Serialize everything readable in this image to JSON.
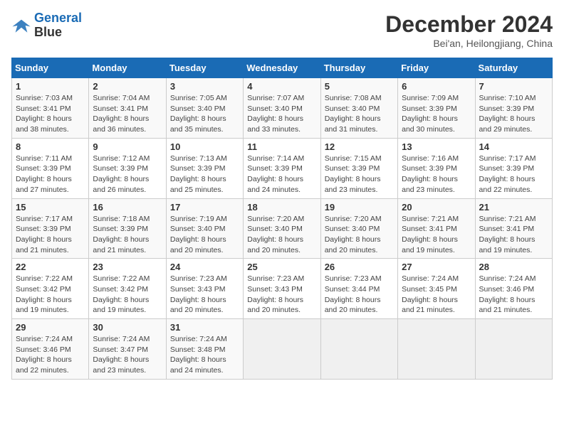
{
  "header": {
    "logo_line1": "General",
    "logo_line2": "Blue",
    "month_title": "December 2024",
    "location": "Bei'an, Heilongjiang, China"
  },
  "weekdays": [
    "Sunday",
    "Monday",
    "Tuesday",
    "Wednesday",
    "Thursday",
    "Friday",
    "Saturday"
  ],
  "weeks": [
    [
      {
        "day": "1",
        "sunrise": "7:03 AM",
        "sunset": "3:41 PM",
        "daylight": "8 hours and 38 minutes."
      },
      {
        "day": "2",
        "sunrise": "7:04 AM",
        "sunset": "3:41 PM",
        "daylight": "8 hours and 36 minutes."
      },
      {
        "day": "3",
        "sunrise": "7:05 AM",
        "sunset": "3:40 PM",
        "daylight": "8 hours and 35 minutes."
      },
      {
        "day": "4",
        "sunrise": "7:07 AM",
        "sunset": "3:40 PM",
        "daylight": "8 hours and 33 minutes."
      },
      {
        "day": "5",
        "sunrise": "7:08 AM",
        "sunset": "3:40 PM",
        "daylight": "8 hours and 31 minutes."
      },
      {
        "day": "6",
        "sunrise": "7:09 AM",
        "sunset": "3:39 PM",
        "daylight": "8 hours and 30 minutes."
      },
      {
        "day": "7",
        "sunrise": "7:10 AM",
        "sunset": "3:39 PM",
        "daylight": "8 hours and 29 minutes."
      }
    ],
    [
      {
        "day": "8",
        "sunrise": "7:11 AM",
        "sunset": "3:39 PM",
        "daylight": "8 hours and 27 minutes."
      },
      {
        "day": "9",
        "sunrise": "7:12 AM",
        "sunset": "3:39 PM",
        "daylight": "8 hours and 26 minutes."
      },
      {
        "day": "10",
        "sunrise": "7:13 AM",
        "sunset": "3:39 PM",
        "daylight": "8 hours and 25 minutes."
      },
      {
        "day": "11",
        "sunrise": "7:14 AM",
        "sunset": "3:39 PM",
        "daylight": "8 hours and 24 minutes."
      },
      {
        "day": "12",
        "sunrise": "7:15 AM",
        "sunset": "3:39 PM",
        "daylight": "8 hours and 23 minutes."
      },
      {
        "day": "13",
        "sunrise": "7:16 AM",
        "sunset": "3:39 PM",
        "daylight": "8 hours and 23 minutes."
      },
      {
        "day": "14",
        "sunrise": "7:17 AM",
        "sunset": "3:39 PM",
        "daylight": "8 hours and 22 minutes."
      }
    ],
    [
      {
        "day": "15",
        "sunrise": "7:17 AM",
        "sunset": "3:39 PM",
        "daylight": "8 hours and 21 minutes."
      },
      {
        "day": "16",
        "sunrise": "7:18 AM",
        "sunset": "3:39 PM",
        "daylight": "8 hours and 21 minutes."
      },
      {
        "day": "17",
        "sunrise": "7:19 AM",
        "sunset": "3:40 PM",
        "daylight": "8 hours and 20 minutes."
      },
      {
        "day": "18",
        "sunrise": "7:20 AM",
        "sunset": "3:40 PM",
        "daylight": "8 hours and 20 minutes."
      },
      {
        "day": "19",
        "sunrise": "7:20 AM",
        "sunset": "3:40 PM",
        "daylight": "8 hours and 20 minutes."
      },
      {
        "day": "20",
        "sunrise": "7:21 AM",
        "sunset": "3:41 PM",
        "daylight": "8 hours and 19 minutes."
      },
      {
        "day": "21",
        "sunrise": "7:21 AM",
        "sunset": "3:41 PM",
        "daylight": "8 hours and 19 minutes."
      }
    ],
    [
      {
        "day": "22",
        "sunrise": "7:22 AM",
        "sunset": "3:42 PM",
        "daylight": "8 hours and 19 minutes."
      },
      {
        "day": "23",
        "sunrise": "7:22 AM",
        "sunset": "3:42 PM",
        "daylight": "8 hours and 19 minutes."
      },
      {
        "day": "24",
        "sunrise": "7:23 AM",
        "sunset": "3:43 PM",
        "daylight": "8 hours and 20 minutes."
      },
      {
        "day": "25",
        "sunrise": "7:23 AM",
        "sunset": "3:43 PM",
        "daylight": "8 hours and 20 minutes."
      },
      {
        "day": "26",
        "sunrise": "7:23 AM",
        "sunset": "3:44 PM",
        "daylight": "8 hours and 20 minutes."
      },
      {
        "day": "27",
        "sunrise": "7:24 AM",
        "sunset": "3:45 PM",
        "daylight": "8 hours and 21 minutes."
      },
      {
        "day": "28",
        "sunrise": "7:24 AM",
        "sunset": "3:46 PM",
        "daylight": "8 hours and 21 minutes."
      }
    ],
    [
      {
        "day": "29",
        "sunrise": "7:24 AM",
        "sunset": "3:46 PM",
        "daylight": "8 hours and 22 minutes."
      },
      {
        "day": "30",
        "sunrise": "7:24 AM",
        "sunset": "3:47 PM",
        "daylight": "8 hours and 23 minutes."
      },
      {
        "day": "31",
        "sunrise": "7:24 AM",
        "sunset": "3:48 PM",
        "daylight": "8 hours and 24 minutes."
      },
      null,
      null,
      null,
      null
    ]
  ]
}
